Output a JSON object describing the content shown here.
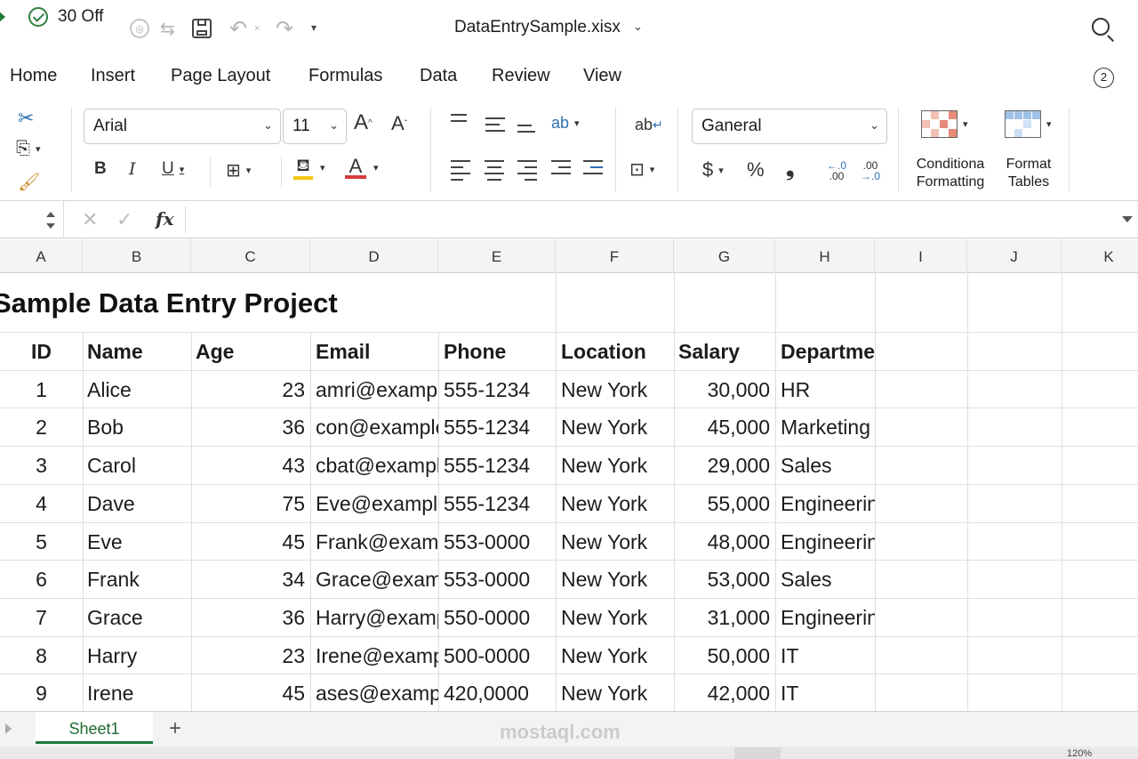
{
  "titlebar": {
    "autosave_label": "30 Off",
    "filename": "DataEntrySample.xisx"
  },
  "tabs": [
    "Home",
    "Insert",
    "Page Layout",
    "Formulas",
    "Data",
    "Review",
    "View"
  ],
  "help_badge": "2",
  "ribbon": {
    "font_name": "Arial",
    "font_size": "11",
    "bold": "B",
    "italic": "I",
    "underline": "U",
    "number_format": "Ganeral",
    "currency": "$",
    "percent": "%",
    "comma": "❟",
    "conditional_formatting": "Conditiona\nFormatting",
    "format_tables": "Format\nTables"
  },
  "formula_bar": {
    "fx": "fx"
  },
  "columns": [
    "A",
    "B",
    "C",
    "D",
    "E",
    "F",
    "G",
    "H",
    "I",
    "J",
    "K"
  ],
  "sheet": {
    "title": "Sample Data Entry Project",
    "headers": [
      "ID",
      "Name",
      "Age",
      "Email",
      "Phone",
      "Location",
      "Salary",
      "Department"
    ],
    "rows": [
      [
        "1",
        "Alice",
        "23",
        "amri@example.com",
        "555-1234",
        "New York",
        "30,000",
        "HR"
      ],
      [
        "2",
        "Bob",
        "36",
        "con@example.com",
        "555-1234",
        "New York",
        "45,000",
        "Marketing"
      ],
      [
        "3",
        "Carol",
        "43",
        "cbat@example.com",
        "555-1234",
        "New York",
        "29,000",
        "Sales"
      ],
      [
        "4",
        "Dave",
        "75",
        "Eve@example.com",
        "555-1234",
        "New York",
        "55,000",
        "Engineering"
      ],
      [
        "5",
        "Eve",
        "45",
        "Frank@example.com",
        "553-0000",
        "New York",
        "48,000",
        "Engineering"
      ],
      [
        "6",
        "Frank",
        "34",
        "Grace@example.com",
        "553-0000",
        "New York",
        "53,000",
        "Sales"
      ],
      [
        "7",
        "Grace",
        "36",
        "Harry@example.com",
        "550-0000",
        "New York",
        "31,000",
        "Engineering"
      ],
      [
        "8",
        "Harry",
        "23",
        "Irene@example.com",
        "500-0000",
        "New York",
        "50,000",
        "IT"
      ],
      [
        "9",
        "Irene",
        "45",
        "ases@example.com",
        "420,0000",
        "New York",
        "42,000",
        "IT"
      ]
    ]
  },
  "sheet_tabs": [
    "Sheet1"
  ],
  "watermark": "mostaql.com",
  "zoom": "120%"
}
